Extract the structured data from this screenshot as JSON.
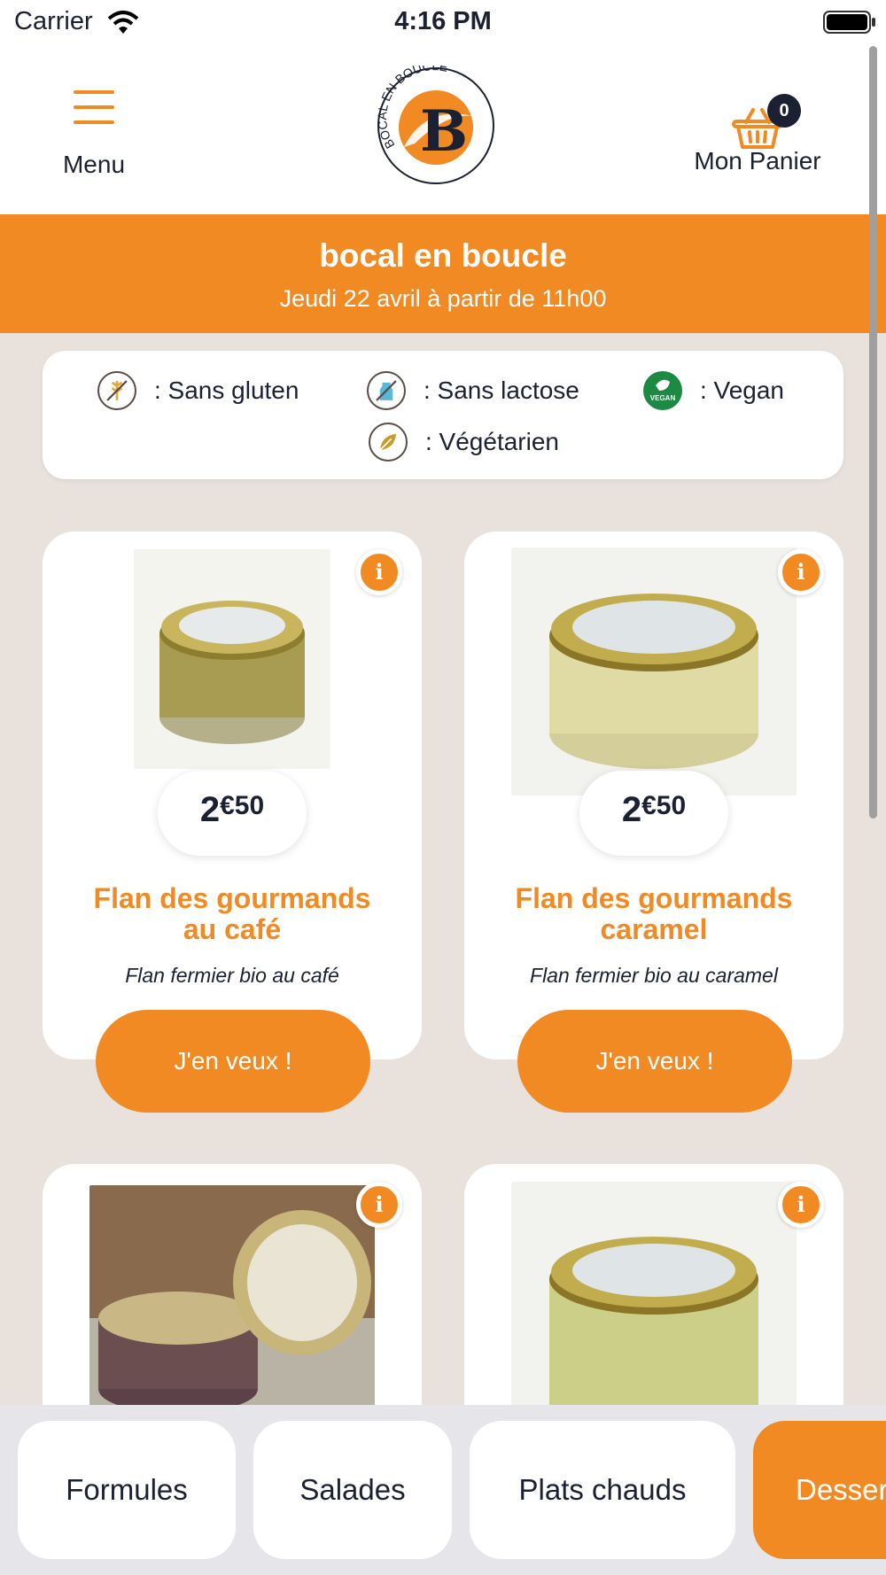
{
  "status_bar": {
    "carrier": "Carrier",
    "time": "4:16 PM"
  },
  "header": {
    "menu_label": "Menu",
    "cart_label": "Mon Panier",
    "cart_count": "0",
    "logo_text": "BOCAL EN BOUCLE"
  },
  "banner": {
    "title": "bocal en boucle",
    "subtitle": "Jeudi 22 avril à partir de 11h00"
  },
  "legend": {
    "gluten_free": ": Sans gluten",
    "lactose_free": ": Sans lactose",
    "vegan": ": Vegan",
    "vegetarian": ": Végétarien",
    "vegan_badge": "VEGAN"
  },
  "products": [
    {
      "price_main": "2",
      "price_sup": "€50",
      "title_line1": "Flan des gourmands",
      "title_line2": "au café",
      "description": "Flan fermier bio au café",
      "cta": "J'en veux !"
    },
    {
      "price_main": "2",
      "price_sup": "€50",
      "title_line1": "Flan des gourmands",
      "title_line2": "caramel",
      "description": "Flan fermier bio au caramel",
      "cta": "J'en veux !"
    },
    {},
    {}
  ],
  "tabs": [
    {
      "label": "Formules"
    },
    {
      "label": "Salades"
    },
    {
      "label": "Plats chauds"
    },
    {
      "label": "Desserts"
    }
  ],
  "colors": {
    "accent": "#f18a22",
    "text": "#1b2032",
    "background": "#e9e2dc",
    "vegan_green": "#1d8a43"
  }
}
